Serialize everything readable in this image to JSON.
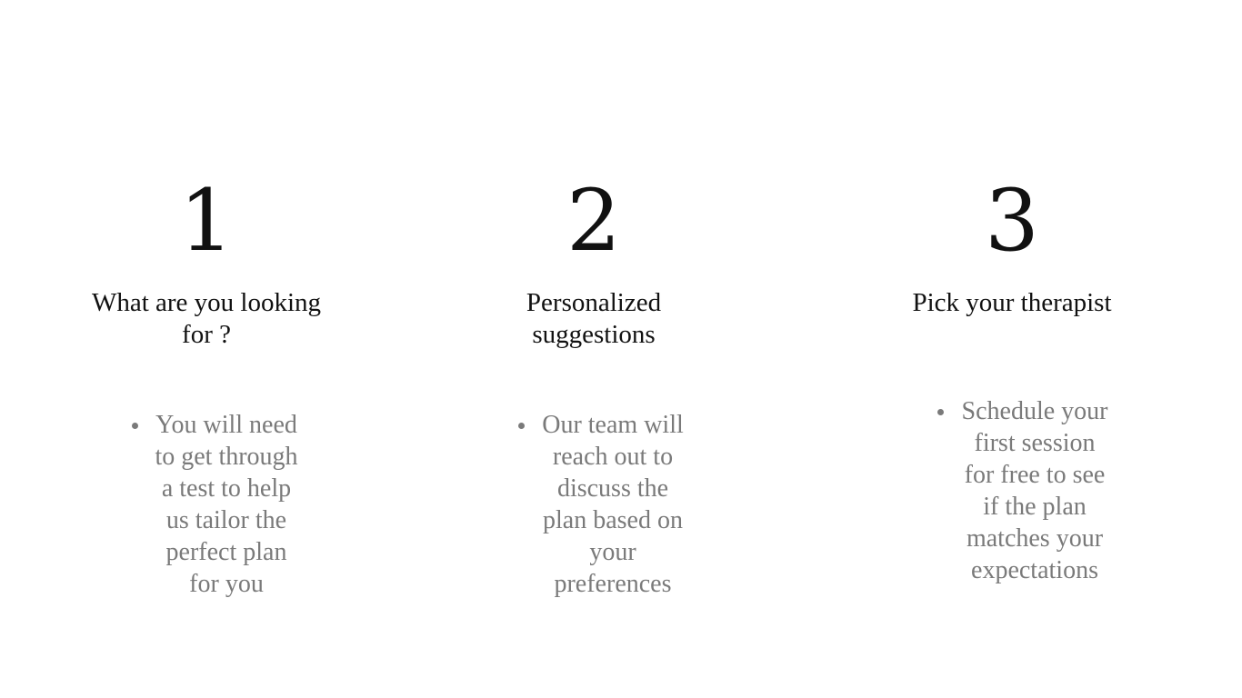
{
  "steps": [
    {
      "number": "1",
      "title": "What are you looking for ?",
      "description": "You will need to get through a test to help us tailor the perfect plan for you"
    },
    {
      "number": "2",
      "title": "Personalized suggestions",
      "description": "Our team will reach out to discuss the plan based on your preferences"
    },
    {
      "number": "3",
      "title": "Pick your therapist",
      "description": "Schedule your first session for free to see if the plan matches your expectations"
    }
  ],
  "colors": {
    "heading": "#111111",
    "body": "#7a7a7a",
    "background": "#ffffff"
  }
}
